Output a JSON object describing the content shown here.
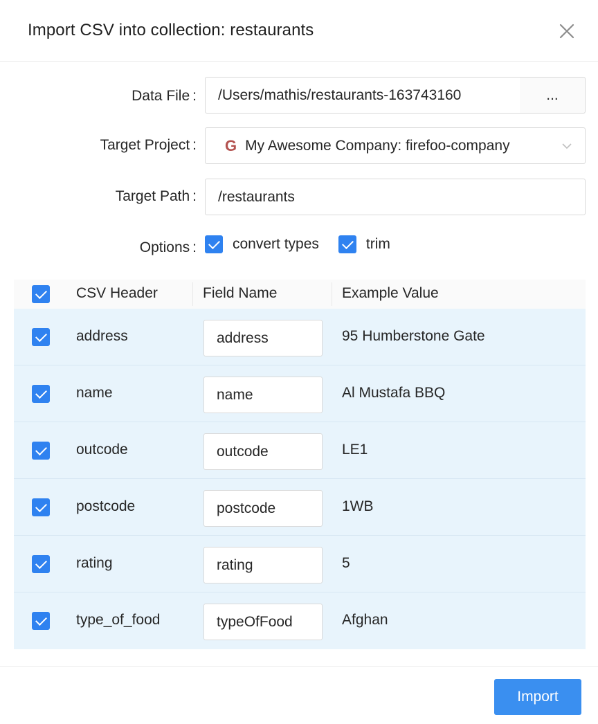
{
  "dialog": {
    "title": "Import CSV into collection: restaurants"
  },
  "form": {
    "data_file": {
      "label": "Data File",
      "value": "/Users/mathis/restaurants-163743160",
      "browse_label": "..."
    },
    "target_project": {
      "label": "Target Project",
      "icon": "G",
      "value": "My Awesome Company: firefoo-company"
    },
    "target_path": {
      "label": "Target Path",
      "value": "/restaurants"
    },
    "options": {
      "label": "Options",
      "items": [
        {
          "label": "convert types",
          "checked": true
        },
        {
          "label": "trim",
          "checked": true
        }
      ]
    }
  },
  "table": {
    "headers": [
      "CSV Header",
      "Field Name",
      "Example Value"
    ],
    "rows": [
      {
        "csv_header": "address",
        "field_name": "address",
        "example": "95 Humberstone Gate",
        "checked": true
      },
      {
        "csv_header": "name",
        "field_name": "name",
        "example": "Al Mustafa BBQ",
        "checked": true
      },
      {
        "csv_header": "outcode",
        "field_name": "outcode",
        "example": "LE1",
        "checked": true
      },
      {
        "csv_header": "postcode",
        "field_name": "postcode",
        "example": "1WB",
        "checked": true
      },
      {
        "csv_header": "rating",
        "field_name": "rating",
        "example": "5",
        "checked": true
      },
      {
        "csv_header": "type_of_food",
        "field_name": "typeOfFood",
        "example": "Afghan",
        "checked": true
      }
    ]
  },
  "footer": {
    "import_label": "Import"
  },
  "colors": {
    "accent": "#3a8ff0",
    "checkbox": "#2f82f0",
    "row_bg": "#e8f4fc",
    "google_icon": "#b3524f"
  }
}
